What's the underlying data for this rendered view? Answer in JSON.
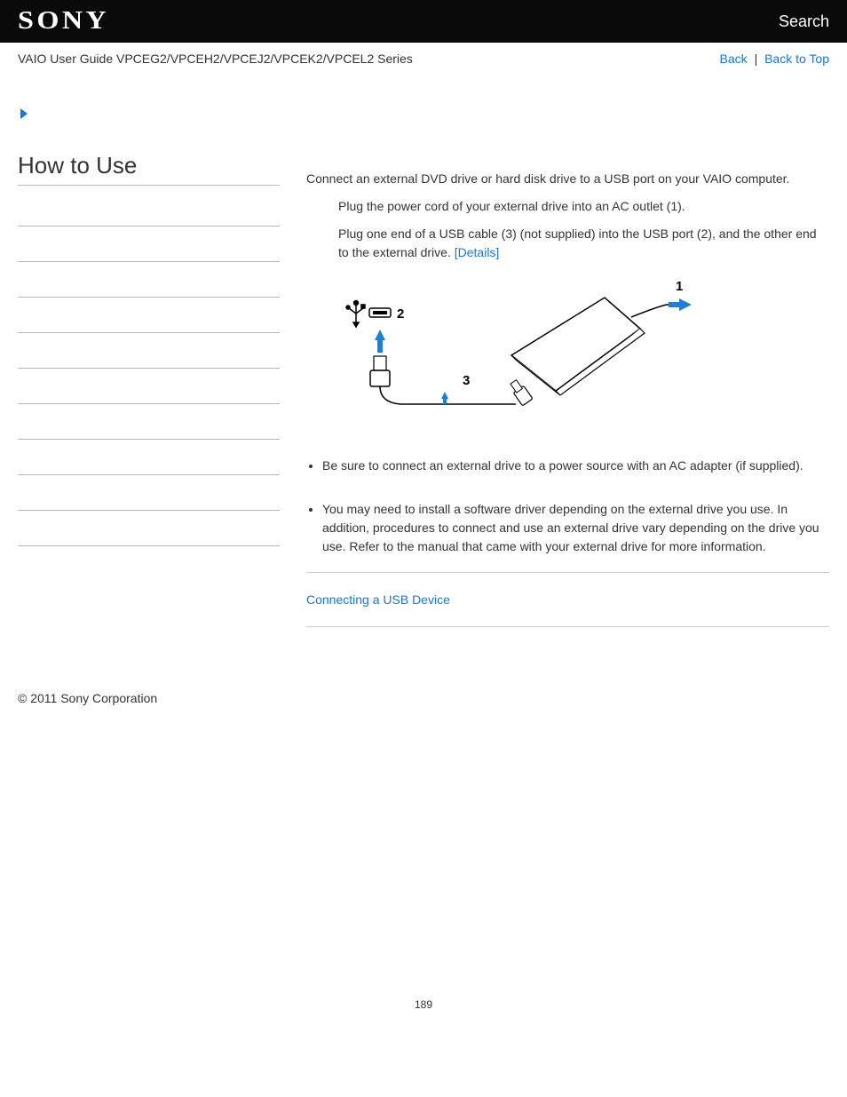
{
  "header": {
    "logo": "SONY",
    "search": "Search"
  },
  "breadcrumb": {
    "title": "VAIO User Guide VPCEG2/VPCEH2/VPCEJ2/VPCEK2/VPCEL2 Series",
    "back": "Back",
    "back_to_top": "Back to Top"
  },
  "sidebar": {
    "title": "How to Use",
    "items": [
      "",
      "",
      "",
      "",
      "",
      "",
      "",
      "",
      "",
      ""
    ]
  },
  "main": {
    "intro": "Connect an external DVD drive or hard disk drive to a USB port on your VAIO computer.",
    "step1": "Plug the power cord of your external drive into an AC outlet (1).",
    "step2_a": "Plug one end of a USB cable (3) (not supplied) into the USB port (2), and the other end to the external drive. ",
    "details_link": "[Details]",
    "diagram_labels": {
      "one": "1",
      "two": "2",
      "three": "3"
    },
    "note1": "Be sure to connect an external drive to a power source with an AC adapter (if supplied).",
    "note2": "You may need to install a software driver depending on the external drive you use. In addition, procedures to connect and use an external drive vary depending on the drive you use. Refer to the manual that came with your external drive for more information.",
    "related": "Connecting a USB Device"
  },
  "footer": {
    "copyright": "© 2011 Sony Corporation",
    "page": "189"
  }
}
